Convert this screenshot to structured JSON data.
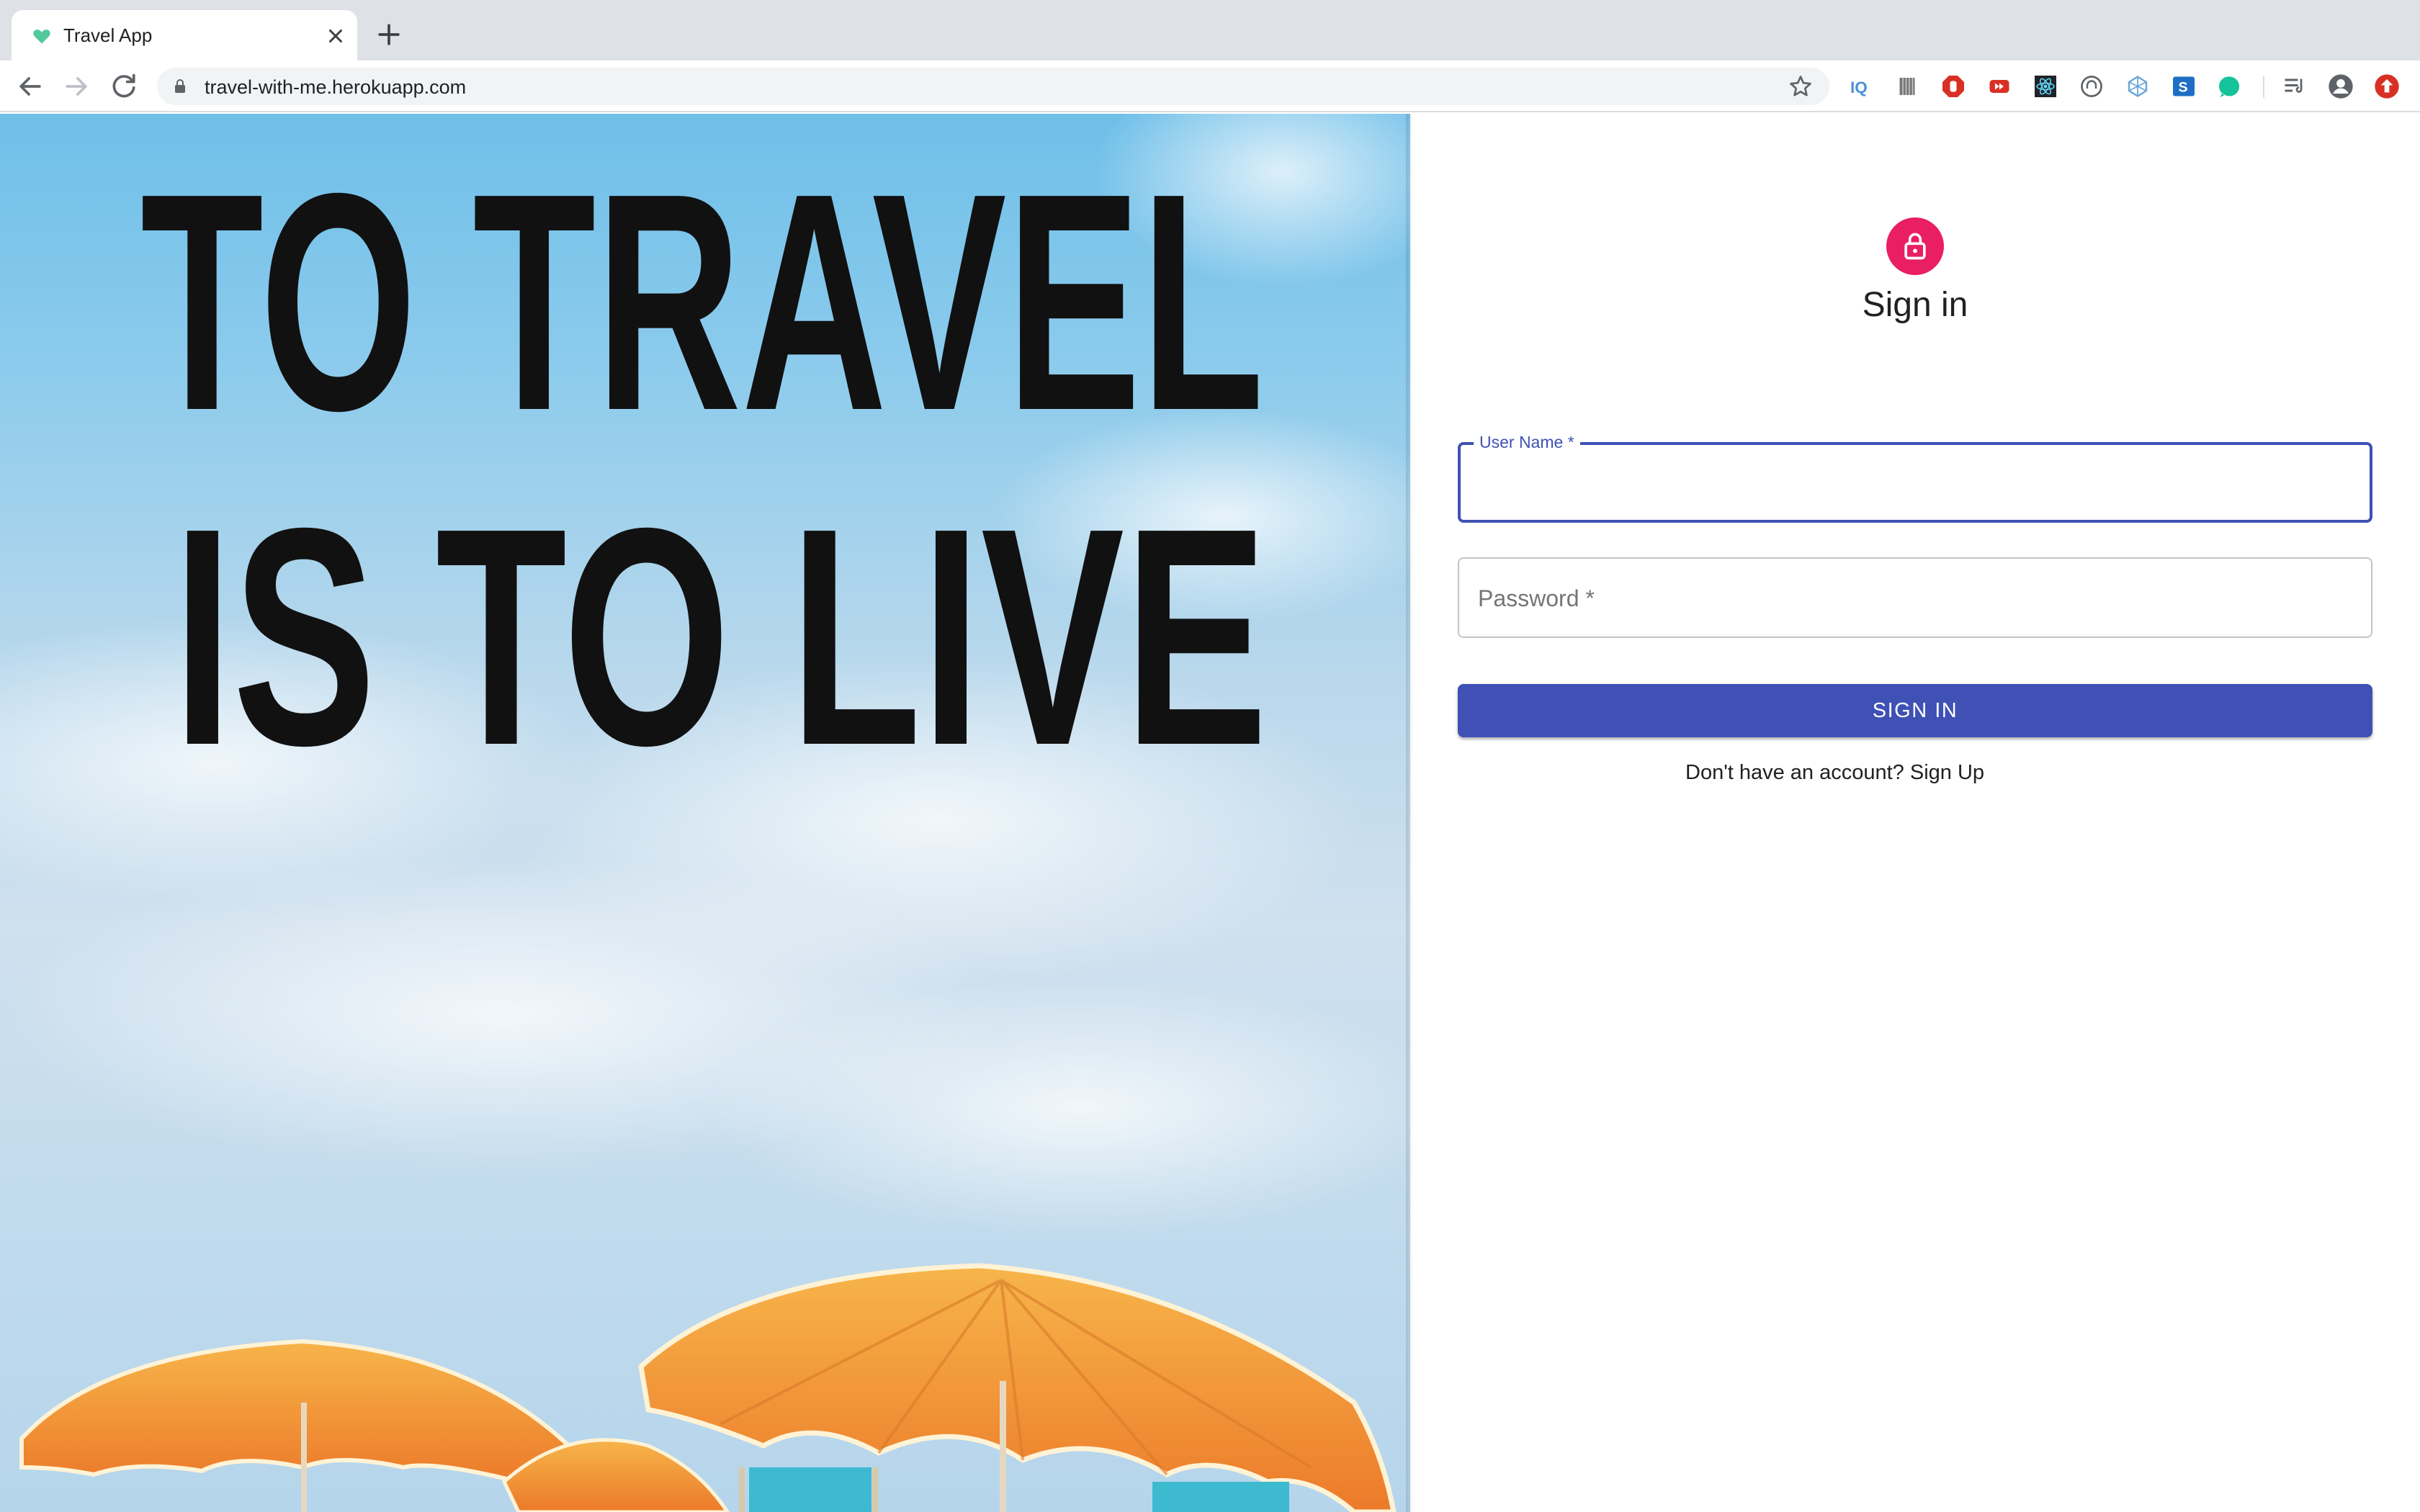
{
  "browser": {
    "tab": {
      "title": "Travel App"
    },
    "address_bar": {
      "url": "travel-with-me.herokuapp.com"
    },
    "extensions": [
      "iq-icon",
      "barcode-icon",
      "adblock-icon",
      "video-speed-icon",
      "react-devtools-icon",
      "headphones-icon",
      "redux-icon",
      "s-extension-icon",
      "grammarly-icon",
      "reading-list-icon",
      "profile-icon",
      "update-icon"
    ]
  },
  "hero": {
    "image_text_line1": "TO TRAVEL",
    "image_text_line2": "IS TO LIVE"
  },
  "signin": {
    "title": "Sign in",
    "username": {
      "label": "User Name *",
      "value": ""
    },
    "password": {
      "placeholder": "Password *",
      "value": ""
    },
    "submit_label": "SIGN IN",
    "signup_link": "Don't have an account? Sign Up"
  },
  "colors": {
    "primary": "#3f51b5",
    "avatar": "#e91e63",
    "umbrella": "#f4a53a"
  }
}
